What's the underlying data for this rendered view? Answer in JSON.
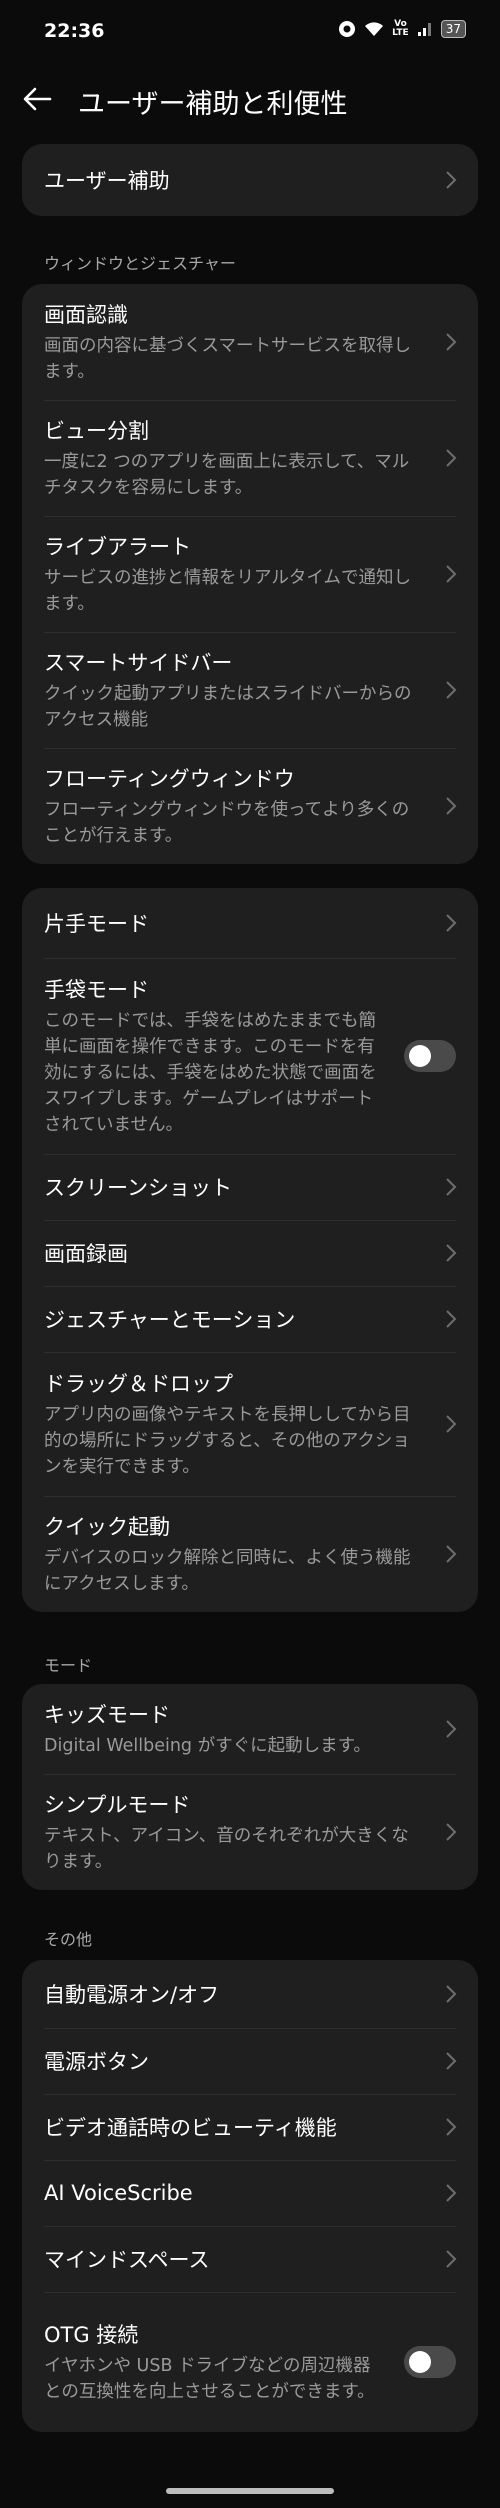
{
  "status": {
    "time": "22:36",
    "battery": "37",
    "network_top": "Vo",
    "network_bottom": "LTE"
  },
  "header": {
    "title": "ユーザー補助と利便性"
  },
  "card0": {
    "items": [
      {
        "title": "ユーザー補助"
      }
    ]
  },
  "section_window": "ウィンドウとジェスチャー",
  "card1": {
    "items": [
      {
        "title": "画面認識",
        "sub": "画面の内容に基づくスマートサービスを取得します。"
      },
      {
        "title": "ビュー分割",
        "sub": "一度に2 つのアプリを画面上に表示して、マルチタスクを容易にします。"
      },
      {
        "title": "ライブアラート",
        "sub": "サービスの進捗と情報をリアルタイムで通知します。"
      },
      {
        "title": "スマートサイドバー",
        "sub": "クイック起動アプリまたはスライドバーからのアクセス機能"
      },
      {
        "title": "フローティングウィンドウ",
        "sub": "フローティングウィンドウを使ってより多くのことが行えます。"
      }
    ]
  },
  "card2": {
    "items": [
      {
        "title": "片手モード"
      },
      {
        "title": "手袋モード",
        "sub": "このモードでは、手袋をはめたままでも簡単に画面を操作できます。このモードを有効にするには、手袋をはめた状態で画面をスワイプします。ゲームプレイはサポートされていません。",
        "toggle": false
      },
      {
        "title": "スクリーンショット"
      },
      {
        "title": "画面録画"
      },
      {
        "title": "ジェスチャーとモーション"
      },
      {
        "title": "ドラッグ＆ドロップ",
        "sub": "アプリ内の画像やテキストを長押ししてから目的の場所にドラッグすると、その他のアクションを実行できます。"
      },
      {
        "title": "クイック起動",
        "sub": "デバイスのロック解除と同時に、よく使う機能にアクセスします。"
      }
    ]
  },
  "section_mode": "モード",
  "card3": {
    "items": [
      {
        "title": "キッズモード",
        "sub": "Digital Wellbeing がすぐに起動します。"
      },
      {
        "title": "シンプルモード",
        "sub": "テキスト、アイコン、音のそれぞれが大きくなります。"
      }
    ]
  },
  "section_other": "その他",
  "card4": {
    "items": [
      {
        "title": "自動電源オン/オフ"
      },
      {
        "title": "電源ボタン"
      },
      {
        "title": "ビデオ通話時のビューティ機能"
      },
      {
        "title": "AI VoiceScribe"
      },
      {
        "title": "マインドスペース"
      },
      {
        "title": "OTG 接続",
        "sub": "イヤホンや USB ドライブなどの周辺機器との互換性を向上させることができます。",
        "toggle": false
      }
    ]
  }
}
